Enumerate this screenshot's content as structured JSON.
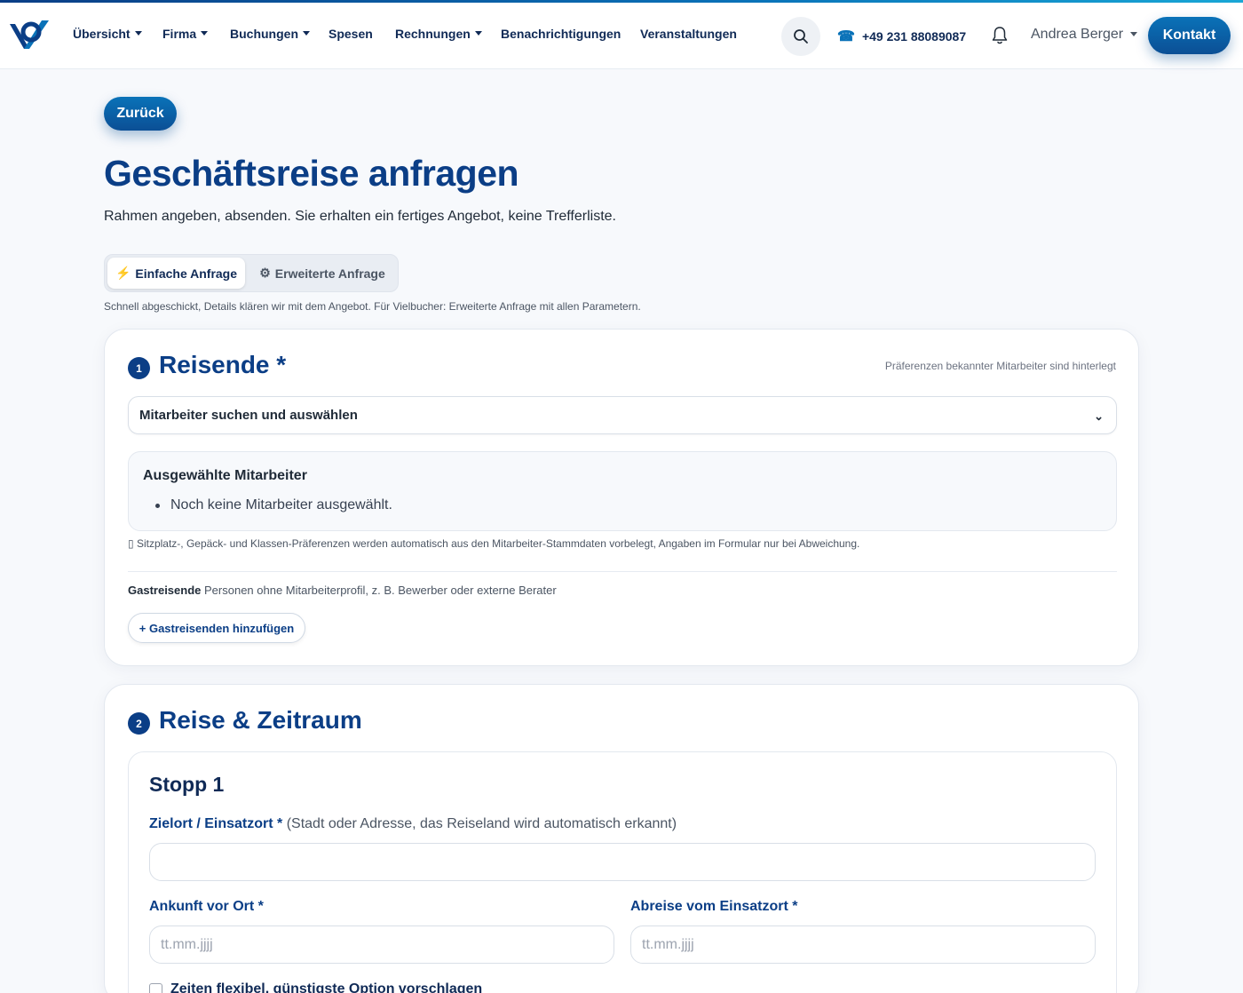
{
  "nav": {
    "items": [
      {
        "label": "Übersicht",
        "has_caret": true
      },
      {
        "label": "Firma",
        "has_caret": true
      },
      {
        "label": "Buchungen",
        "has_caret": true
      },
      {
        "label": "Spesen",
        "has_caret": false
      },
      {
        "label": "Rechnungen",
        "has_caret": true
      },
      {
        "label": "Benachrichtigungen",
        "has_caret": false
      },
      {
        "label": "Veranstaltungen",
        "has_caret": false
      }
    ],
    "search_icon": "search-icon",
    "phone_icon": "☎",
    "phone": "+49 231 88089087",
    "bell_icon": "bell-icon",
    "user": "Andrea Berger",
    "contact_button": "Kontakt"
  },
  "page": {
    "back_button": "Zurück",
    "title": "Geschäftsreise anfragen",
    "subtitle": "Rahmen angeben, absenden. Sie erhalten ein fertiges Angebot, keine Trefferliste."
  },
  "mode_toggle": {
    "simple_icon": "⚡",
    "simple_label": "Einfache Anfrage",
    "extended_icon": "⚙",
    "extended_label": "Erweiterte Anfrage",
    "active": "simple",
    "hint": "Schnell abgeschickt, Details klären wir mit dem Angebot. Für Vielbucher: Erweiterte Anfrage mit allen Parametern."
  },
  "section1": {
    "number": "1",
    "title": "Reisende *",
    "right_note": "Präferenzen bekannter Mitarbeiter sind hinterlegt",
    "select_label": "Mitarbeiter suchen und auswählen",
    "select_chevron": "⌄",
    "selected_title": "Ausgewählte Mitarbeiter",
    "selected_empty": "Noch keine Mitarbeiter ausgewählt.",
    "preference_note": "▯ Sitzplatz-, Gepäck- und Klassen-Präferenzen werden automatisch aus den Mitarbeiter-Stammdaten vorbelegt, Angaben im Formular nur bei Abweichung.",
    "guest_label": "Gastreisende",
    "guest_description": "Personen ohne Mitarbeiterprofil, z. B. Bewerber oder externe Berater",
    "add_guest_button": "+ Gastreisenden hinzufügen"
  },
  "section2": {
    "number": "2",
    "title": "Reise & Zeitraum",
    "stop_title": "Stopp 1",
    "destination_label": "Zielort / Einsatzort *",
    "destination_hint": "(Stadt oder Adresse, das Reiseland wird automatisch erkannt)",
    "destination_value": "",
    "arrival_label": "Ankunft vor Ort *",
    "arrival_placeholder": "tt.mm.jjjj",
    "departure_label": "Abreise vom Einsatzort *",
    "departure_placeholder": "tt.mm.jjjj",
    "flexible_label": "Zeiten flexibel, günstigste Option vorschlagen",
    "flexible_checked": false
  },
  "colors": {
    "brand_dark": "#0b3e86",
    "brand_accent": "#0a72b8",
    "page_bg": "#f7f9fc"
  }
}
